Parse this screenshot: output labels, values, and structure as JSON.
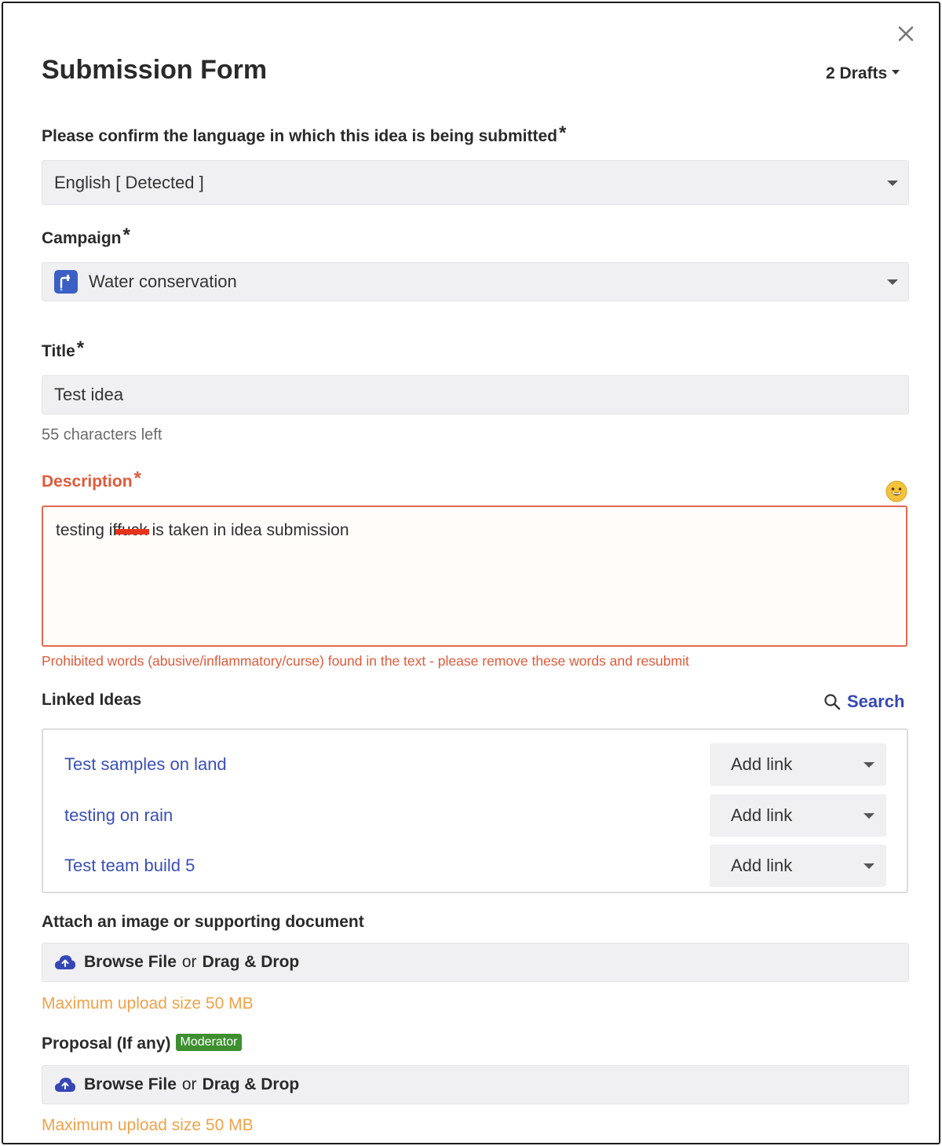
{
  "header": {
    "title": "Submission Form",
    "drafts_label": "2 Drafts"
  },
  "language": {
    "label": "Please confirm the language in which this idea is being submitted",
    "required_mark": "*",
    "value": "English [ Detected ]"
  },
  "campaign": {
    "label": "Campaign",
    "required_mark": "*",
    "value": "Water conservation",
    "icon": "faucet-icon",
    "icon_color": "#3b5fc4"
  },
  "title_field": {
    "label": "Title",
    "required_mark": "*",
    "value": "Test idea",
    "helper": "55 characters left"
  },
  "description": {
    "label": "Description",
    "required_mark": "*",
    "text_before": "testing if",
    "redacted_word": "fuck",
    "text_after": " is taken in idea submission",
    "error": "Prohibited words (abusive/inflammatory/curse) found in the text - please remove these words and resubmit",
    "error_color": "#e05a3a"
  },
  "linked_ideas": {
    "label": "Linked Ideas",
    "search_label": "Search",
    "items": [
      {
        "title": "Test samples on land",
        "action": "Add link"
      },
      {
        "title": "testing on rain",
        "action": "Add link"
      },
      {
        "title": "Test team build 5",
        "action": "Add link"
      }
    ]
  },
  "attachment": {
    "label": "Attach an image or supporting document",
    "browse": "Browse File",
    "or": "or",
    "drag": "Drag & Drop",
    "max_size": "Maximum upload size 50 MB"
  },
  "proposal": {
    "label": "Proposal (If any)",
    "badge": "Moderator",
    "badge_color": "#3d8f2f",
    "browse": "Browse File",
    "or": "or",
    "drag": "Drag & Drop",
    "max_size": "Maximum upload size 50 MB"
  },
  "colors": {
    "accent": "#3547b5",
    "link": "#3a4fb8",
    "warning": "#f0a24a"
  }
}
